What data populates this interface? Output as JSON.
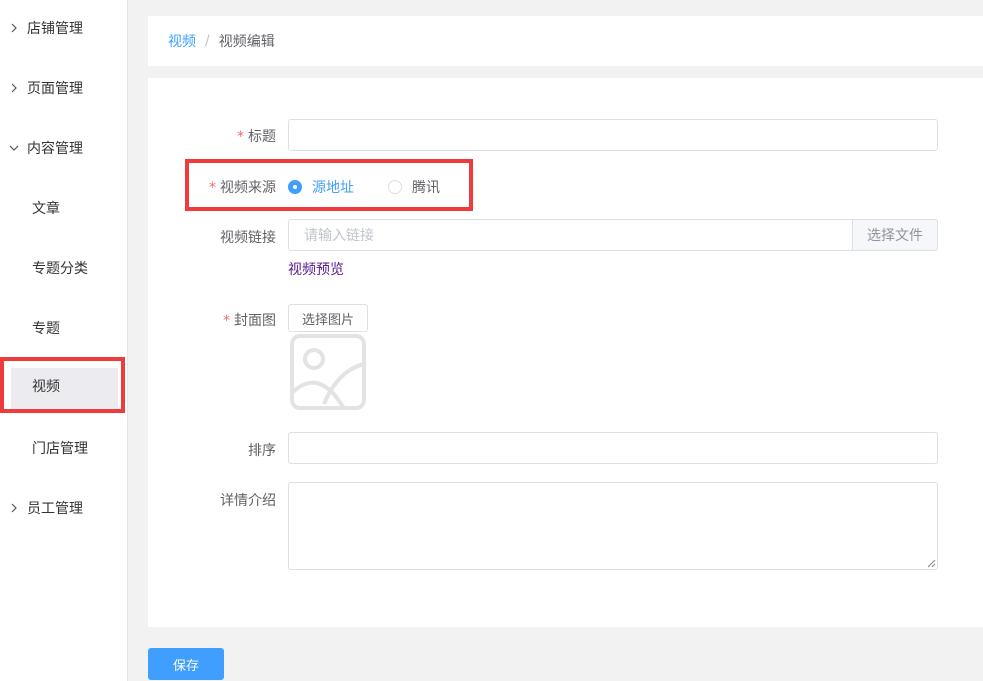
{
  "sidebar": {
    "groups": [
      {
        "label": "店铺管理"
      },
      {
        "label": "页面管理"
      },
      {
        "label": "内容管理"
      },
      {
        "label": "员工管理"
      }
    ],
    "content_children": [
      {
        "label": "文章"
      },
      {
        "label": "专题分类"
      },
      {
        "label": "专题"
      },
      {
        "label": "视频"
      },
      {
        "label": "门店管理"
      }
    ]
  },
  "breadcrumb": {
    "parent": "视频",
    "separator": "/",
    "current": "视频编辑"
  },
  "form": {
    "title": {
      "label": "标题",
      "value": ""
    },
    "source": {
      "label": "视频来源",
      "options": [
        {
          "label": "源地址",
          "checked": true
        },
        {
          "label": "腾讯",
          "checked": false
        }
      ]
    },
    "link": {
      "label": "视频链接",
      "placeholder": "请输入链接",
      "choose_file": "选择文件",
      "preview": "视频预览"
    },
    "cover": {
      "label": "封面图",
      "choose_image": "选择图片"
    },
    "sort": {
      "label": "排序",
      "value": ""
    },
    "detail": {
      "label": "详情介绍",
      "value": ""
    }
  },
  "actions": {
    "save": "保存"
  },
  "colors": {
    "primary": "#409eff",
    "highlight": "#ef3b3b",
    "required": "#f56c6c"
  }
}
